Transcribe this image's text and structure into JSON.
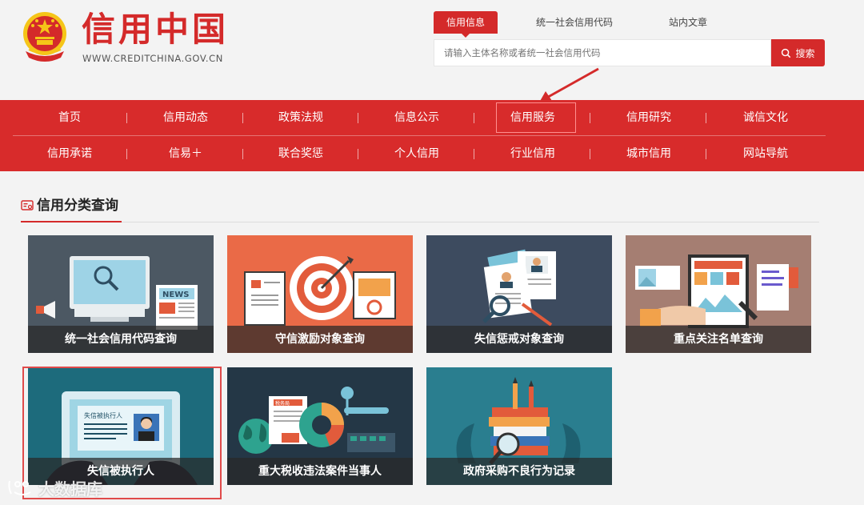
{
  "header": {
    "logo_cn": "信用中国",
    "logo_url": "WWW.CREDITCHINA.GOV.CN"
  },
  "search": {
    "tabs": [
      {
        "label": "信用信息",
        "active": true
      },
      {
        "label": "统一社会信用代码",
        "active": false
      },
      {
        "label": "站内文章",
        "active": false
      }
    ],
    "placeholder": "请输入主体名称或者统一社会信用代码",
    "button_label": "搜索",
    "button_icon": "search-icon"
  },
  "nav": {
    "row1": [
      "首页",
      "信用动态",
      "政策法规",
      "信息公示",
      "信用服务",
      "信用研究",
      "诚信文化"
    ],
    "row2": [
      "信用承诺",
      "信易＋",
      "联合奖惩",
      "个人信用",
      "行业信用",
      "城市信用",
      "网站导航"
    ],
    "highlighted": "信用服务"
  },
  "section": {
    "title": "信用分类查询",
    "icon": "credit-card-icon"
  },
  "cards": [
    {
      "label": "统一社会信用代码查询",
      "icon": "computer-news-icon"
    },
    {
      "label": "守信激励对象查询",
      "icon": "target-icon"
    },
    {
      "label": "失信惩戒对象查询",
      "icon": "resume-magnifier-icon"
    },
    {
      "label": "重点关注名单查询",
      "icon": "document-hand-icon"
    },
    {
      "label": "失信被执行人",
      "icon": "laptop-id-icon",
      "highlighted": true
    },
    {
      "label": "重大税收违法案件当事人",
      "icon": "globe-chart-icon"
    },
    {
      "label": "政府采购不良行为记录",
      "icon": "books-magnifier-icon"
    }
  ],
  "colors": {
    "brand_red": "#d42a2a",
    "nav_red": "#d82b2b",
    "background": "#f3f3f3"
  },
  "watermark": {
    "text": "大数据库"
  }
}
